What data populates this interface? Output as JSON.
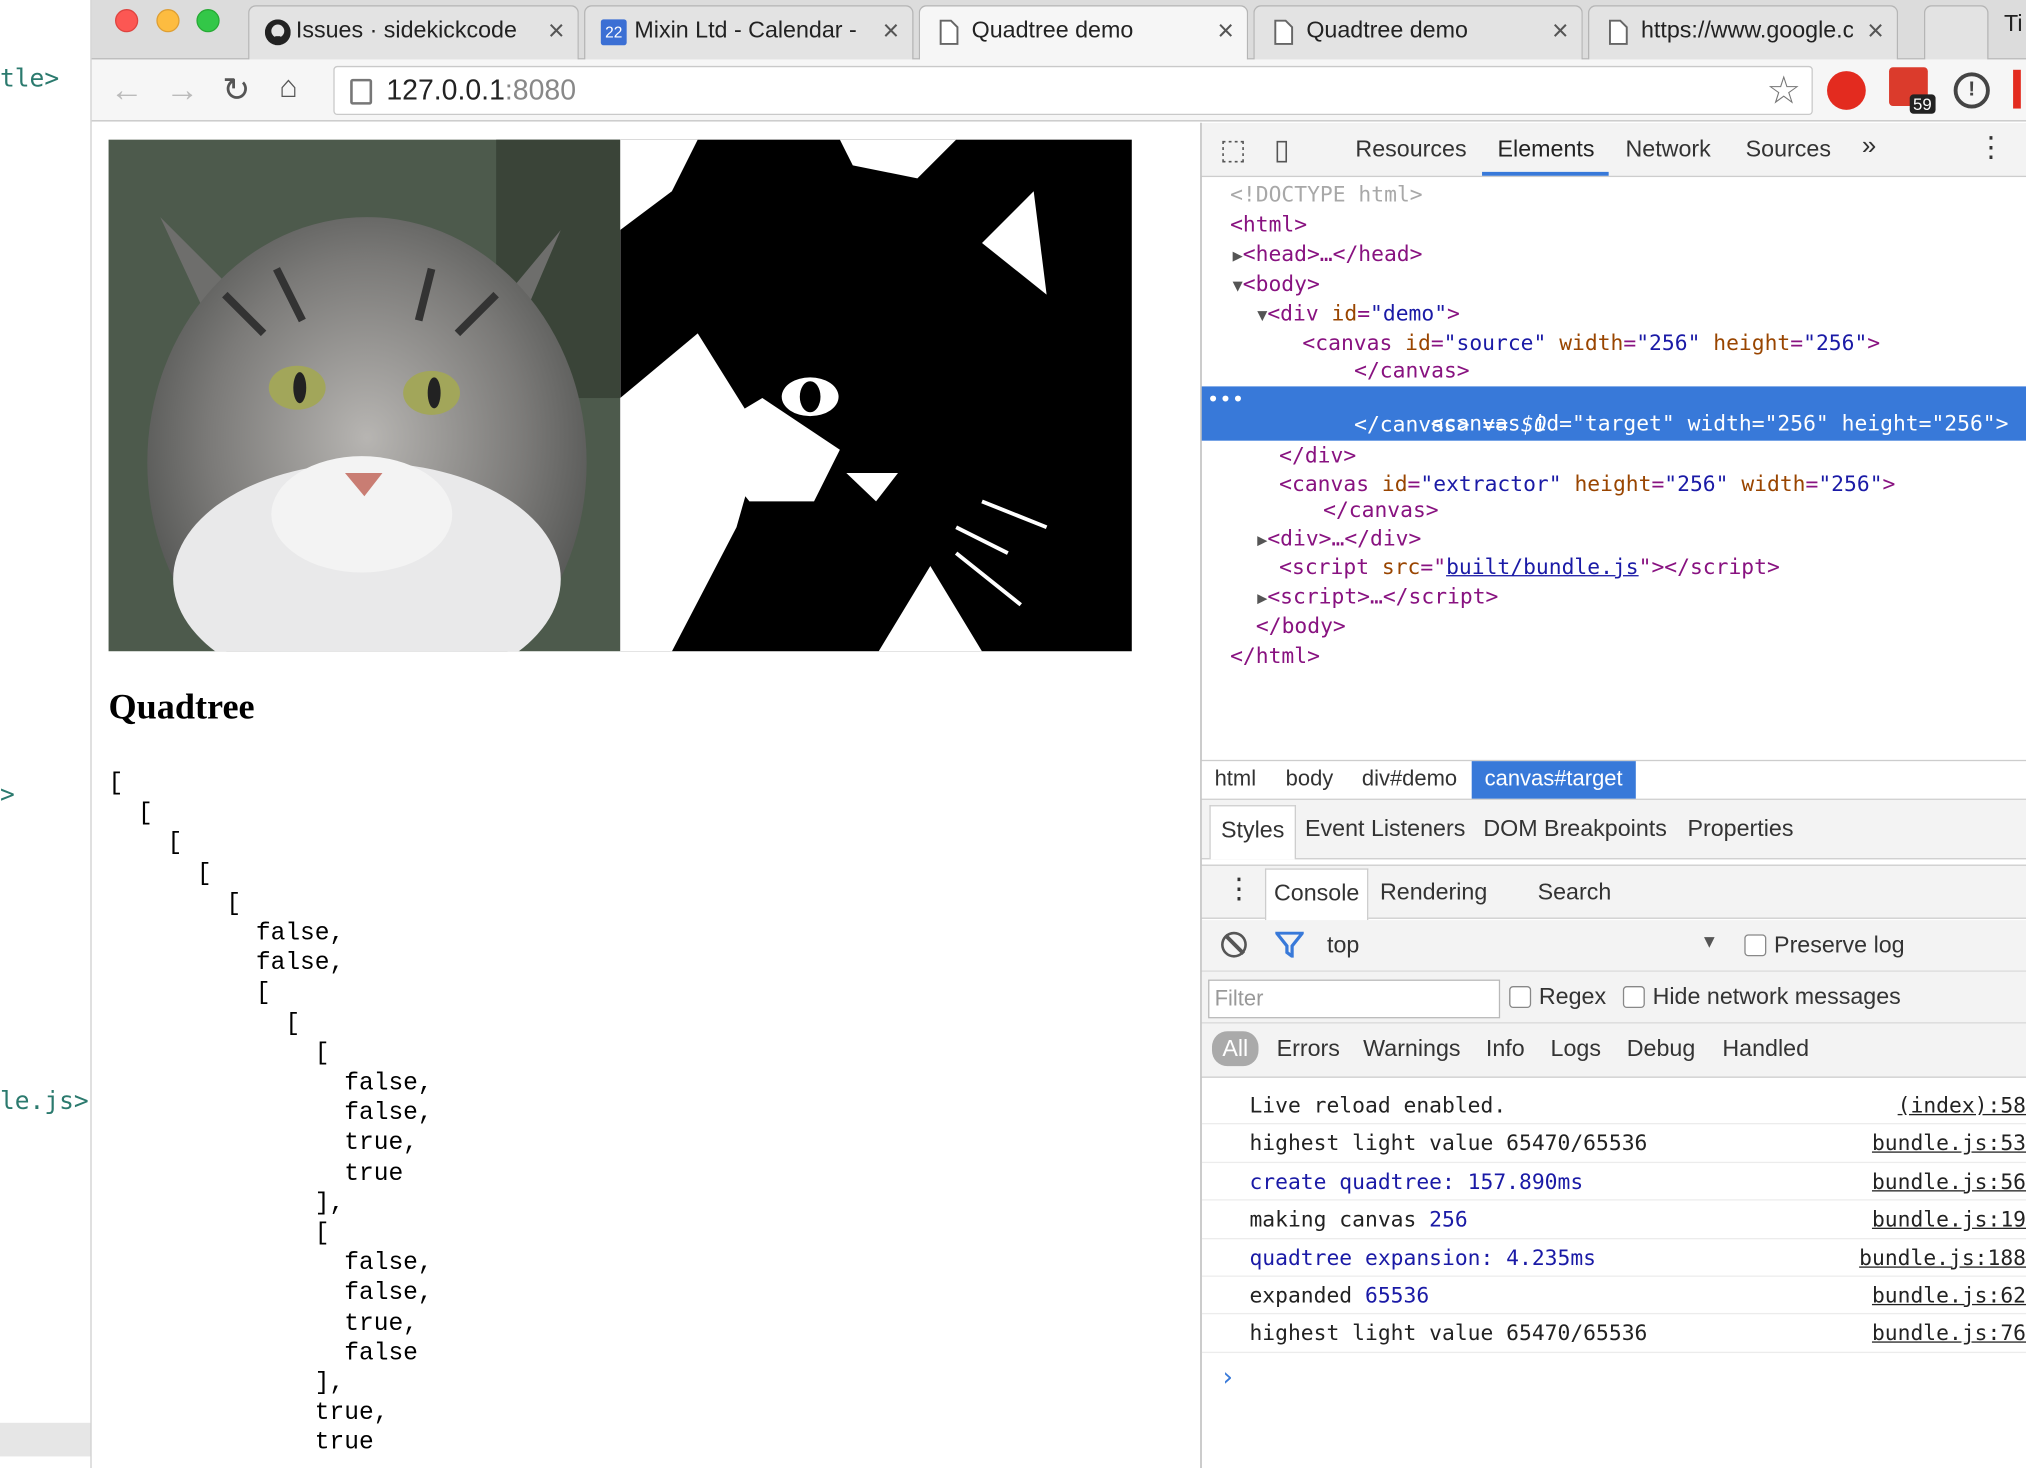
{
  "editor": {
    "line1": "tle>",
    "line2": ">",
    "line3": "le.js>"
  },
  "browser": {
    "tabs": [
      {
        "title": "Issues · sidekickcode",
        "icon": "github-icon"
      },
      {
        "title": "Mixin Ltd - Calendar - ",
        "icon": "calendar-icon",
        "badge": "22"
      },
      {
        "title": "Quadtree demo",
        "icon": "page-icon",
        "active": true
      },
      {
        "title": "Quadtree demo",
        "icon": "page-icon"
      },
      {
        "title": "https://www.google.co",
        "icon": "page-icon"
      }
    ],
    "overflow_tab_text": "Ti",
    "url_host": "127.0.0.1",
    "url_port": ":8080",
    "ext_badge": "59"
  },
  "page": {
    "heading": "Quadtree",
    "images": {
      "source_alt": "source-canvas",
      "target_alt": "target-canvas"
    },
    "quadtree_lines": [
      "[",
      "  [",
      "    [",
      "      [",
      "        [",
      "          false,",
      "          false,",
      "          [",
      "            [",
      "              [",
      "                false,",
      "                false,",
      "                true,",
      "                true",
      "              ],",
      "              [",
      "                false,",
      "                false,",
      "                true,",
      "                false",
      "              ],",
      "              true,",
      "              true"
    ]
  },
  "devtools": {
    "tabs": [
      "Resources",
      "Elements",
      "Network",
      "Sources"
    ],
    "active_tab": "Elements",
    "dom": {
      "doctype": "<!DOCTYPE html>",
      "demo_id": "\"demo\"",
      "source_id": "\"source\"",
      "target_id": "\"target\"",
      "extractor_id": "\"extractor\"",
      "size_val": "\"256\"",
      "script_src": "built/bundle.js",
      "selected_marker": "== $0"
    },
    "breadcrumbs": [
      "html",
      "body",
      "div#demo",
      "canvas#target"
    ],
    "subtabs": [
      "Styles",
      "Event Listeners",
      "DOM Breakpoints",
      "Properties"
    ],
    "drawer_tabs": [
      "Console",
      "Rendering",
      "Search"
    ],
    "context": "top",
    "preserve_log": "Preserve log",
    "filter_placeholder": "Filter",
    "regex": "Regex",
    "hide_network": "Hide network messages",
    "levels": [
      "All",
      "Errors",
      "Warnings",
      "Info",
      "Logs",
      "Debug",
      "Handled"
    ],
    "console": [
      {
        "text": "Live reload enabled.",
        "num": "",
        "src": "(index):58",
        "blue": false
      },
      {
        "text": "highest light value 65470/65536",
        "num": "",
        "src": "bundle.js:53",
        "blue": false
      },
      {
        "text": "create quadtree: 157.890ms",
        "num": "",
        "src": "bundle.js:56",
        "blue": true
      },
      {
        "text": "making canvas ",
        "num": "256",
        "src": "bundle.js:19",
        "blue": false
      },
      {
        "text": "quadtree expansion: 4.235ms",
        "num": "",
        "src": "bundle.js:188",
        "blue": true
      },
      {
        "text": "expanded ",
        "num": "65536",
        "src": "bundle.js:62",
        "blue": false
      },
      {
        "text": "highest light value 65470/65536",
        "num": "",
        "src": "bundle.js:76",
        "blue": false
      }
    ]
  }
}
